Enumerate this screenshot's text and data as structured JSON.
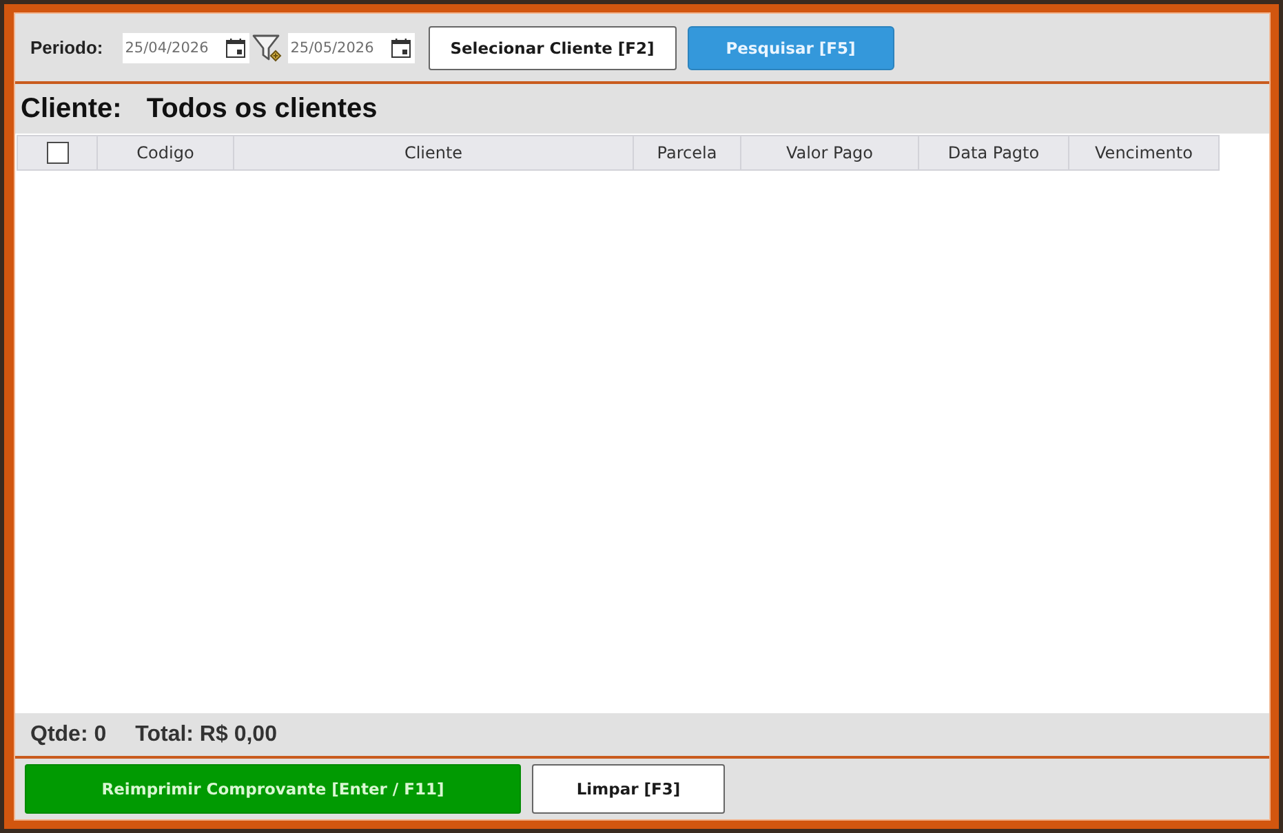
{
  "filter_bar": {
    "period_label": "Periodo:",
    "start_date": "25/04/2026",
    "end_date": "25/05/2026",
    "buttons": [
      {
        "label": "Selecionar Cliente [F2]",
        "kind": "secondary"
      },
      {
        "label": "Pesquisar [F5]",
        "kind": "primary"
      }
    ]
  },
  "client": {
    "label": "Cliente:",
    "value": "Todos os clientes"
  },
  "table": {
    "select_all": {
      "checked": false
    },
    "columns": [
      "Codigo",
      "Cliente",
      "Parcela",
      "Valor Pago",
      "Data Pagto",
      "Vencimento"
    ]
  },
  "summary": {
    "count": "Qtde: 0",
    "total": "Total: R$ 0,00"
  },
  "actions": [
    {
      "label": "Reimprimir Comprovante [Enter / F11]",
      "kind": "success"
    },
    {
      "label": "Limpar [F3]",
      "kind": "secondary"
    }
  ]
}
